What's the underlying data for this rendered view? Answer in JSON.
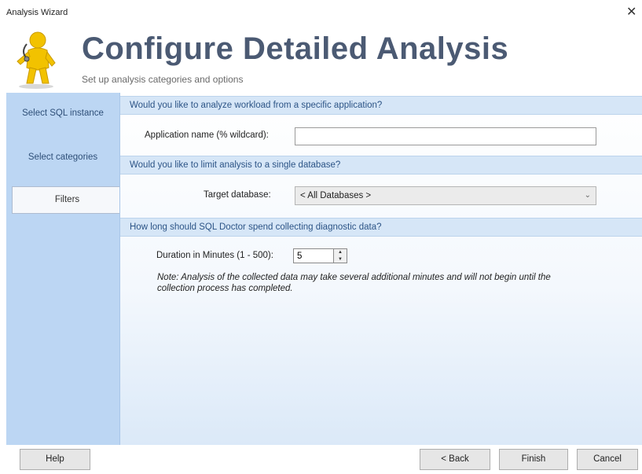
{
  "window": {
    "title": "Analysis Wizard",
    "close_glyph": "✕"
  },
  "header": {
    "title": "Configure Detailed Analysis",
    "subtitle": "Set up analysis categories and options",
    "mascot_icon": "wizard-mascot-icon"
  },
  "sidebar": {
    "items": [
      {
        "label": "Select SQL instance",
        "active": false
      },
      {
        "label": "Select categories",
        "active": false
      },
      {
        "label": "Filters",
        "active": true
      }
    ]
  },
  "sections": {
    "application": {
      "header": "Would you like to analyze workload from a specific application?",
      "label": "Application name (% wildcard):",
      "value": ""
    },
    "database": {
      "header": "Would you like to limit analysis to a single database?",
      "label": "Target database:",
      "selected": "< All Databases >"
    },
    "duration": {
      "header": "How long should SQL Doctor spend collecting diagnostic data?",
      "label": "Duration in Minutes (1 - 500):",
      "value": "5",
      "note": "Note: Analysis of the collected data may take several additional minutes and will not begin until the collection process has completed."
    }
  },
  "buttons": {
    "help": "Help",
    "back": "< Back",
    "finish": "Finish",
    "cancel": "Cancel"
  },
  "colors": {
    "sidebar_bg": "#bcd6f3",
    "section_header_bg": "#d6e6f7",
    "title_color": "#4b5a73",
    "section_header_text": "#2c5486"
  }
}
